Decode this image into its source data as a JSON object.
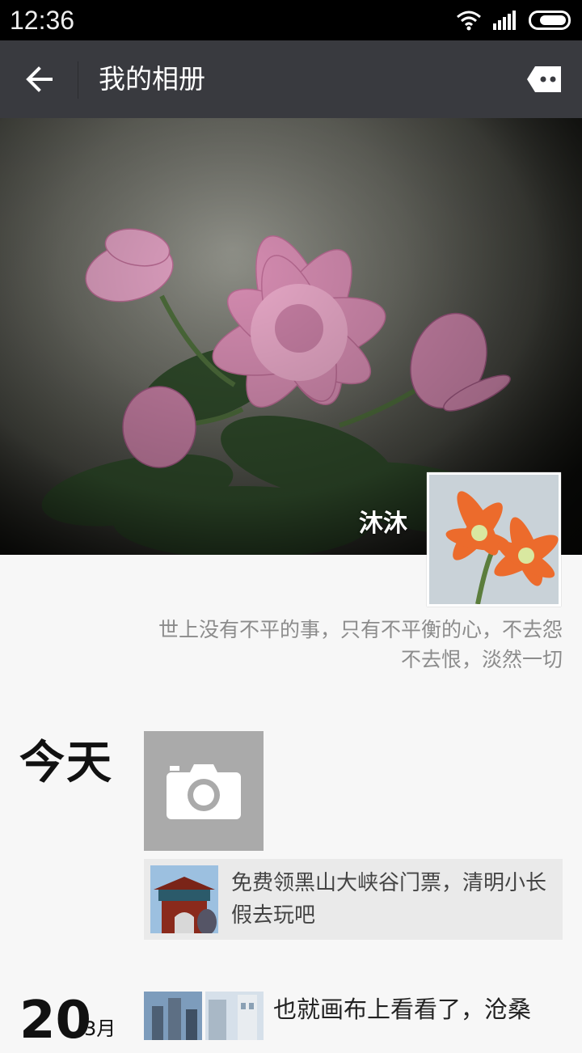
{
  "status_bar": {
    "time": "12:36"
  },
  "header": {
    "title": "我的相册"
  },
  "profile": {
    "nickname": "沐沐",
    "signature": "世上没有不平的事，只有不平衡的心，不去怨不去恨，淡然一切"
  },
  "timeline": {
    "today_label": "今天",
    "ad_text": "免费领黑山大峡谷门票，清明小长假去玩吧",
    "post_day": "20",
    "post_month": "3月",
    "post_text": "也就画布上看看了，沧桑"
  },
  "icons": {
    "back": "arrow-left-icon",
    "message": "message-icon",
    "camera": "camera-icon",
    "wifi": "wifi-icon",
    "signal": "signal-icon",
    "battery": "battery-icon"
  }
}
